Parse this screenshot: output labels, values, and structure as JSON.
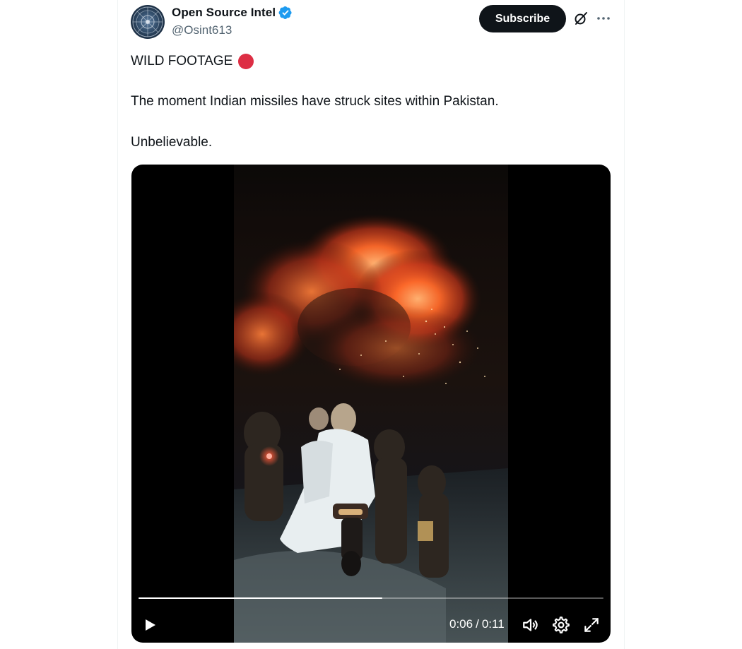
{
  "author": {
    "display_name": "Open Source Intel",
    "handle": "@Osint613",
    "verified": true
  },
  "actions": {
    "subscribe_label": "Subscribe",
    "grok_icon": "grok-icon",
    "more_icon": "more-icon"
  },
  "tweet": {
    "line1": "WILD FOOTAGE",
    "line1_emoji": "red-circle",
    "line2": "The moment Indian missiles have struck sites within Pakistan.",
    "line3": "Unbelievable."
  },
  "video": {
    "current_time": "0:06",
    "separator": "/",
    "duration": "0:11",
    "progress_fraction": 0.525,
    "controls": [
      "play-icon",
      "volume-icon",
      "settings-icon",
      "fullscreen-icon"
    ]
  },
  "colors": {
    "verified_blue": "#1d9bf0",
    "red_dot": "#dd2e44",
    "button_bg": "#0f1419",
    "handle_gray": "#536471"
  }
}
